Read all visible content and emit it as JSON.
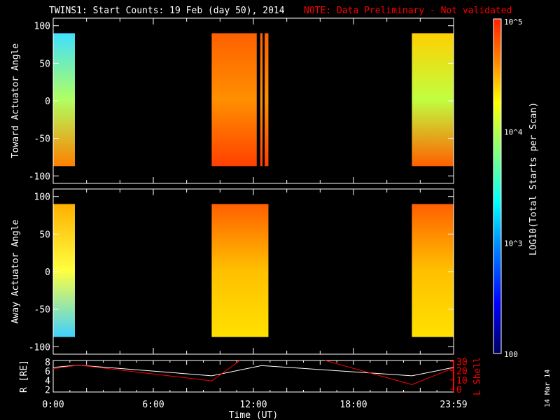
{
  "title": "TWINS1: Start Counts: 19 Feb (day  50), 2014",
  "note": "NOTE: Data Preliminary - Not validated",
  "date_stamp": "14 Mar 14",
  "colors": {
    "note": "#ff0000",
    "axis": "#ffffff",
    "lshell": "#ff0000",
    "radius": "#ffffff"
  },
  "chart_data": [
    {
      "type": "heatmap",
      "ylabel": "Toward Actuator Angle",
      "ylim": [
        -110,
        110
      ],
      "yticks": [
        "100",
        "50",
        "0",
        "-50",
        "-100"
      ],
      "ytick_values": [
        100,
        50,
        0,
        -50,
        -100
      ],
      "blocks": [
        {
          "t0": 0.0,
          "t1": 1.3,
          "level": "cyan-yellow"
        },
        {
          "t0": 9.5,
          "t1": 12.9,
          "level": "orange-red"
        },
        {
          "t0": 21.5,
          "t1": 24.0,
          "level": "yellow-green"
        }
      ]
    },
    {
      "type": "heatmap",
      "ylabel": "Away Actuator Angle",
      "ylim": [
        -110,
        110
      ],
      "yticks": [
        "100",
        "50",
        "0",
        "-50",
        "-100"
      ],
      "ytick_values": [
        100,
        50,
        0,
        -50,
        -100
      ],
      "blocks": [
        {
          "t0": 0.0,
          "t1": 1.3,
          "level": "yellow-cyan"
        },
        {
          "t0": 9.5,
          "t1": 12.9,
          "level": "orange-yellow"
        },
        {
          "t0": 21.5,
          "t1": 24.0,
          "level": "orange-yellow"
        }
      ]
    },
    {
      "type": "line",
      "ylabel": "R [RE]",
      "y2label": "L Shell",
      "xlabel": "Time (UT)",
      "xticks": [
        "0:00",
        "6:00",
        "12:00",
        "18:00",
        "23:59"
      ],
      "xtick_values": [
        0,
        6,
        12,
        18,
        24
      ],
      "yticks": [
        "8",
        "6",
        "4",
        "2"
      ],
      "ytick_values": [
        8,
        6,
        4,
        2
      ],
      "ylim": [
        1.5,
        8.3
      ],
      "y2ticks": [
        "30",
        "20",
        "10",
        "0"
      ],
      "y2tick_values": [
        30,
        20,
        10,
        0
      ],
      "y2lim": [
        -3,
        31
      ],
      "series": [
        {
          "name": "R",
          "x": [
            0,
            1.5,
            9.5,
            12.5,
            21.5,
            24
          ],
          "values": [
            6.8,
            7.3,
            5.0,
            7.2,
            5.0,
            6.8
          ]
        },
        {
          "name": "L Shell",
          "segments": [
            {
              "x": [
                0,
                1.5,
                9.5,
                11.2
              ],
              "values": [
                22,
                26,
                9,
                31
              ]
            },
            {
              "x": [
                16.3,
                21.5,
                24
              ],
              "values": [
                31,
                5,
                23
              ]
            }
          ]
        }
      ]
    }
  ],
  "colorbar": {
    "label": "LOG10(Total Starts per Scan)",
    "ticks": [
      "10^5",
      "10^4",
      "10^3",
      "100"
    ],
    "tick_values": [
      5,
      4,
      3,
      2
    ]
  }
}
